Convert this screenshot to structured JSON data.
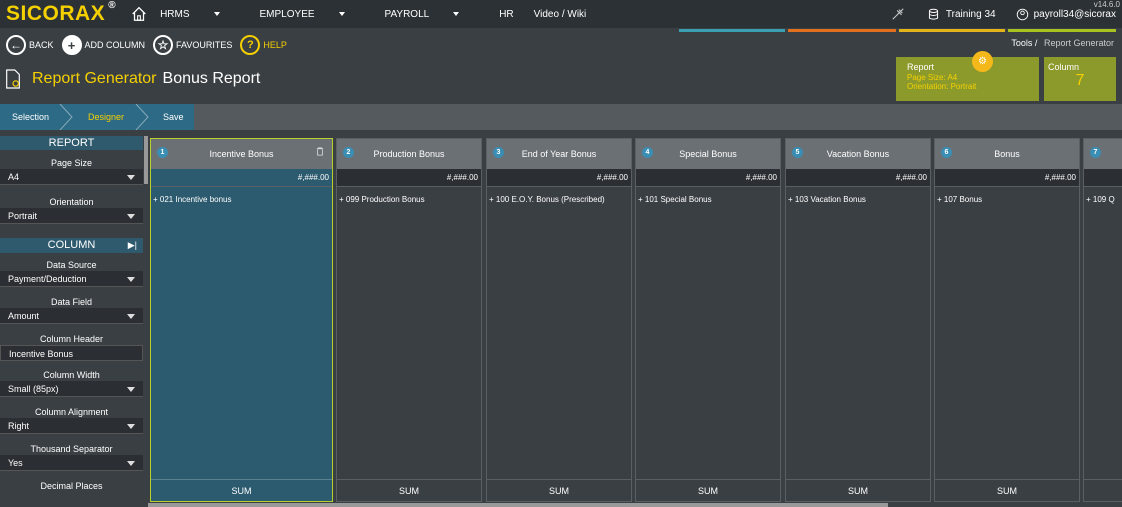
{
  "app": {
    "logo": "SICORAX",
    "logo_mark": "®",
    "version": "v14.6.0"
  },
  "nav": {
    "items": [
      {
        "label": "HRMS",
        "active": true,
        "dropdown": true
      },
      {
        "label": "EMPLOYEE",
        "active": false,
        "dropdown": true
      },
      {
        "label": "PAYROLL",
        "active": false,
        "dropdown": true
      },
      {
        "label": "HR",
        "active": false,
        "dropdown": false
      },
      {
        "label": "Video / Wiki",
        "active": false,
        "dropdown": false
      }
    ]
  },
  "topright": {
    "database": "Training 34",
    "user": "payroll34@sicorax"
  },
  "stripes": [
    "#3a9fb0",
    "#e0701e",
    "#e3b51b",
    "#a8c21f"
  ],
  "toolbar": {
    "back": "BACK",
    "add_column": "ADD COLUMN",
    "favourites": "FAVOURITES",
    "help": "HELP"
  },
  "breadcrumb": {
    "root": "Tools",
    "sep": "/",
    "current": "Report Generator"
  },
  "page": {
    "title": "Report Generator",
    "subtitle": "Bonus Report"
  },
  "report_card": {
    "title": "Report",
    "page_size": "Page Size: A4",
    "orientation": "Orientation: Portrait"
  },
  "column_card": {
    "title": "Column",
    "count": "7"
  },
  "steps": [
    {
      "label": "Selection",
      "state": "done"
    },
    {
      "label": "Designer",
      "state": "active"
    },
    {
      "label": "Save",
      "state": "todo"
    }
  ],
  "sidebar": {
    "report_header": "REPORT",
    "page_size_label": "Page Size",
    "page_size_value": "A4",
    "orientation_label": "Orientation",
    "orientation_value": "Portrait",
    "column_header": "COLUMN",
    "data_source_label": "Data Source",
    "data_source_value": "Payment/Deduction",
    "data_field_label": "Data Field",
    "data_field_value": "Amount",
    "column_header_label": "Column Header",
    "column_header_value": "Incentive Bonus",
    "column_width_label": "Column Width",
    "column_width_value": "Small (85px)",
    "column_alignment_label": "Column Alignment",
    "column_alignment_value": "Right",
    "thousand_sep_label": "Thousand Separator",
    "thousand_sep_value": "Yes",
    "decimal_label": "Decimal Places"
  },
  "columns": [
    {
      "num": "1",
      "title": "Incentive Bonus",
      "format": "#,###.00",
      "field": "+ 021 Incentive bonus",
      "footer": "SUM"
    },
    {
      "num": "2",
      "title": "Production Bonus",
      "format": "#,###.00",
      "field": "+ 099 Production Bonus",
      "footer": "SUM"
    },
    {
      "num": "3",
      "title": "End of Year Bonus",
      "format": "#,###.00",
      "field": "+ 100 E.O.Y. Bonus (Prescribed)",
      "footer": "SUM"
    },
    {
      "num": "4",
      "title": "Special Bonus",
      "format": "#,###.00",
      "field": "+ 101 Special Bonus",
      "footer": "SUM"
    },
    {
      "num": "5",
      "title": "Vacation Bonus",
      "format": "#,###.00",
      "field": "+ 103 Vacation Bonus",
      "footer": "SUM"
    },
    {
      "num": "6",
      "title": "Bonus",
      "format": "#,###.00",
      "field": "+ 107 Bonus",
      "footer": "SUM"
    },
    {
      "num": "7",
      "title": "",
      "format": "",
      "field": "+ 109 Q",
      "footer": ""
    }
  ]
}
